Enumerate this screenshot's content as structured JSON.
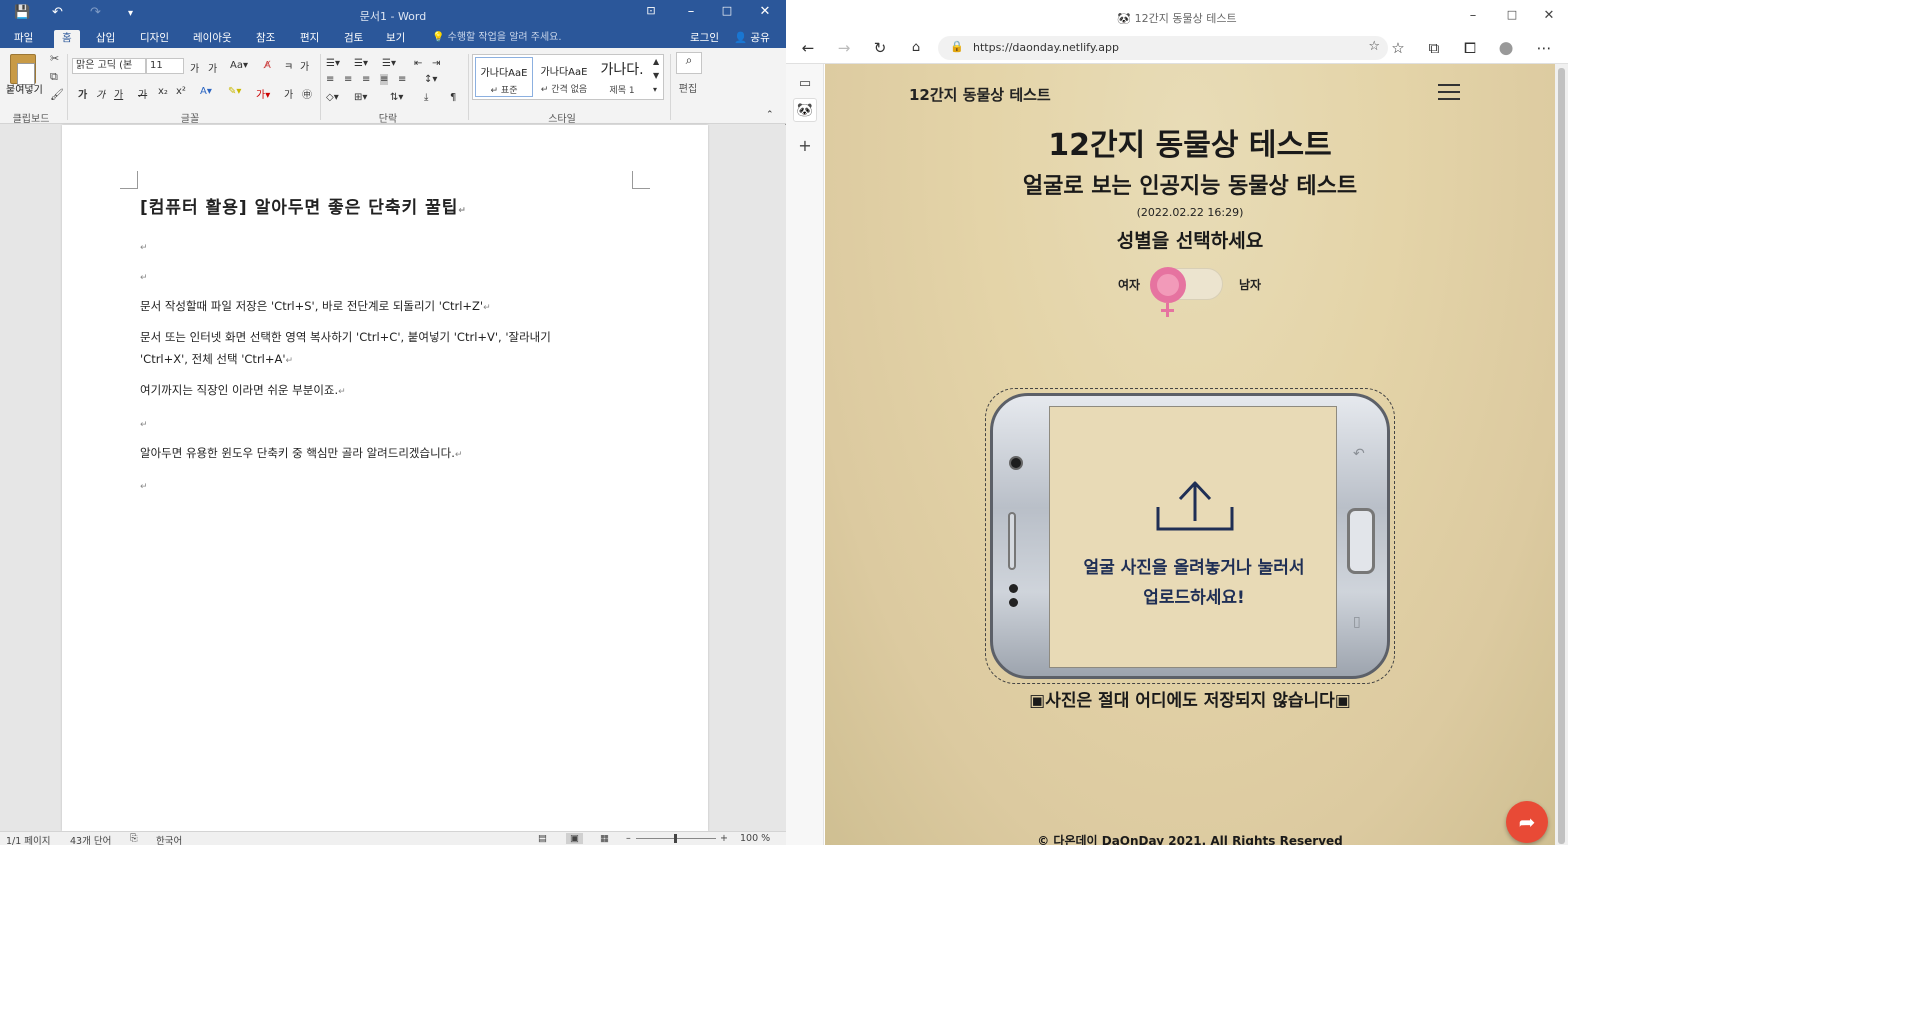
{
  "word": {
    "qat": {
      "save": "💾",
      "undo": "↶",
      "redo": "↷",
      "customize": "▾"
    },
    "title": "문서1 - Word",
    "tabs": [
      "파일",
      "홈",
      "삽입",
      "디자인",
      "레이아웃",
      "참조",
      "편지",
      "검토",
      "보기"
    ],
    "tell_me": "수행할 작업을 알려 주세요.",
    "login": "로그인",
    "share": "공유",
    "ribbon": {
      "paste_label": "붙여넣기",
      "clipboard_group": "클립보드",
      "font_name": "맑은 고딕 (본",
      "font_size": "11",
      "font_group": "글꼴",
      "paragraph_group": "단락",
      "styles_group": "스타일",
      "styles": [
        {
          "preview": "가나다AaE",
          "name": "↵ 표준"
        },
        {
          "preview": "가나다AaE",
          "name": "↵ 간격 없음"
        },
        {
          "preview": "가나다.",
          "name": "제목 1"
        }
      ],
      "edit_label": "편집"
    },
    "document": {
      "heading": "[컴퓨터 활용] 알아두면 좋은 단축키 꿀팁",
      "para1": "문서 작성할때 파일 저장은 'Ctrl+S', 바로 전단계로 되돌리기 'Ctrl+Z'",
      "para2_line1": "문서 또는 인터넷 화면 선택한 영역 복사하기 'Ctrl+C', 붙여넣기 'Ctrl+V', '잘라내기",
      "para2_line2": "'Ctrl+X', 전체 선택 'Ctrl+A'",
      "para3": "여기까지는 직장인 이라면 쉬운 부분이죠.",
      "para4": "알아두면 유용한 윈도우 단축키 중 핵심만 골라 알려드리겠습니다.",
      "mark": "↵"
    },
    "status": {
      "page": "1/1 페이지",
      "words": "43개 단어",
      "lang": "한국어",
      "zoom": "100 %"
    }
  },
  "edge": {
    "title": "12간지 동물상 테스트",
    "url": "https://daonday.netlify.app",
    "page": {
      "brand": "12간지 동물상 테스트",
      "title": "12간지 동물상 테스트",
      "subtitle": "얼굴로 보는 인공지능 동물상 테스트",
      "date": "(2022.02.22 16:29)",
      "gender_prompt": "성별을 선택하세요",
      "female": "여자",
      "male": "남자",
      "upload_line1": "얼굴 사진을 올려놓거나 눌러서",
      "upload_line2": "업로드하세요!",
      "notice": "▣사진은 절대 어디에도 저장되지 않습니다▣",
      "footer": "© 다온데이 DaOnDay 2021. All Rights Reserved"
    }
  }
}
